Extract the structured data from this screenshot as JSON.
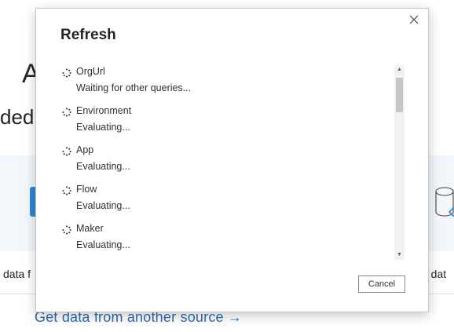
{
  "background": {
    "heading_fragment": "A",
    "subheading_fragment": "ded,",
    "tile_left_label": "data f",
    "tile_right_label": "e dat",
    "link_text": "Get data from another source →"
  },
  "dialog": {
    "title": "Refresh",
    "close_icon": "close-icon",
    "queries": [
      {
        "name": "OrgUrl",
        "status": "Waiting for other queries..."
      },
      {
        "name": "Environment",
        "status": "Evaluating..."
      },
      {
        "name": "App",
        "status": "Evaluating..."
      },
      {
        "name": "Flow",
        "status": "Evaluating..."
      },
      {
        "name": "Maker",
        "status": "Evaluating..."
      }
    ],
    "cancel_label": "Cancel"
  },
  "colors": {
    "accent": "#2b6cb0",
    "band": "#f3f7fc",
    "border": "#c8c6c4"
  }
}
